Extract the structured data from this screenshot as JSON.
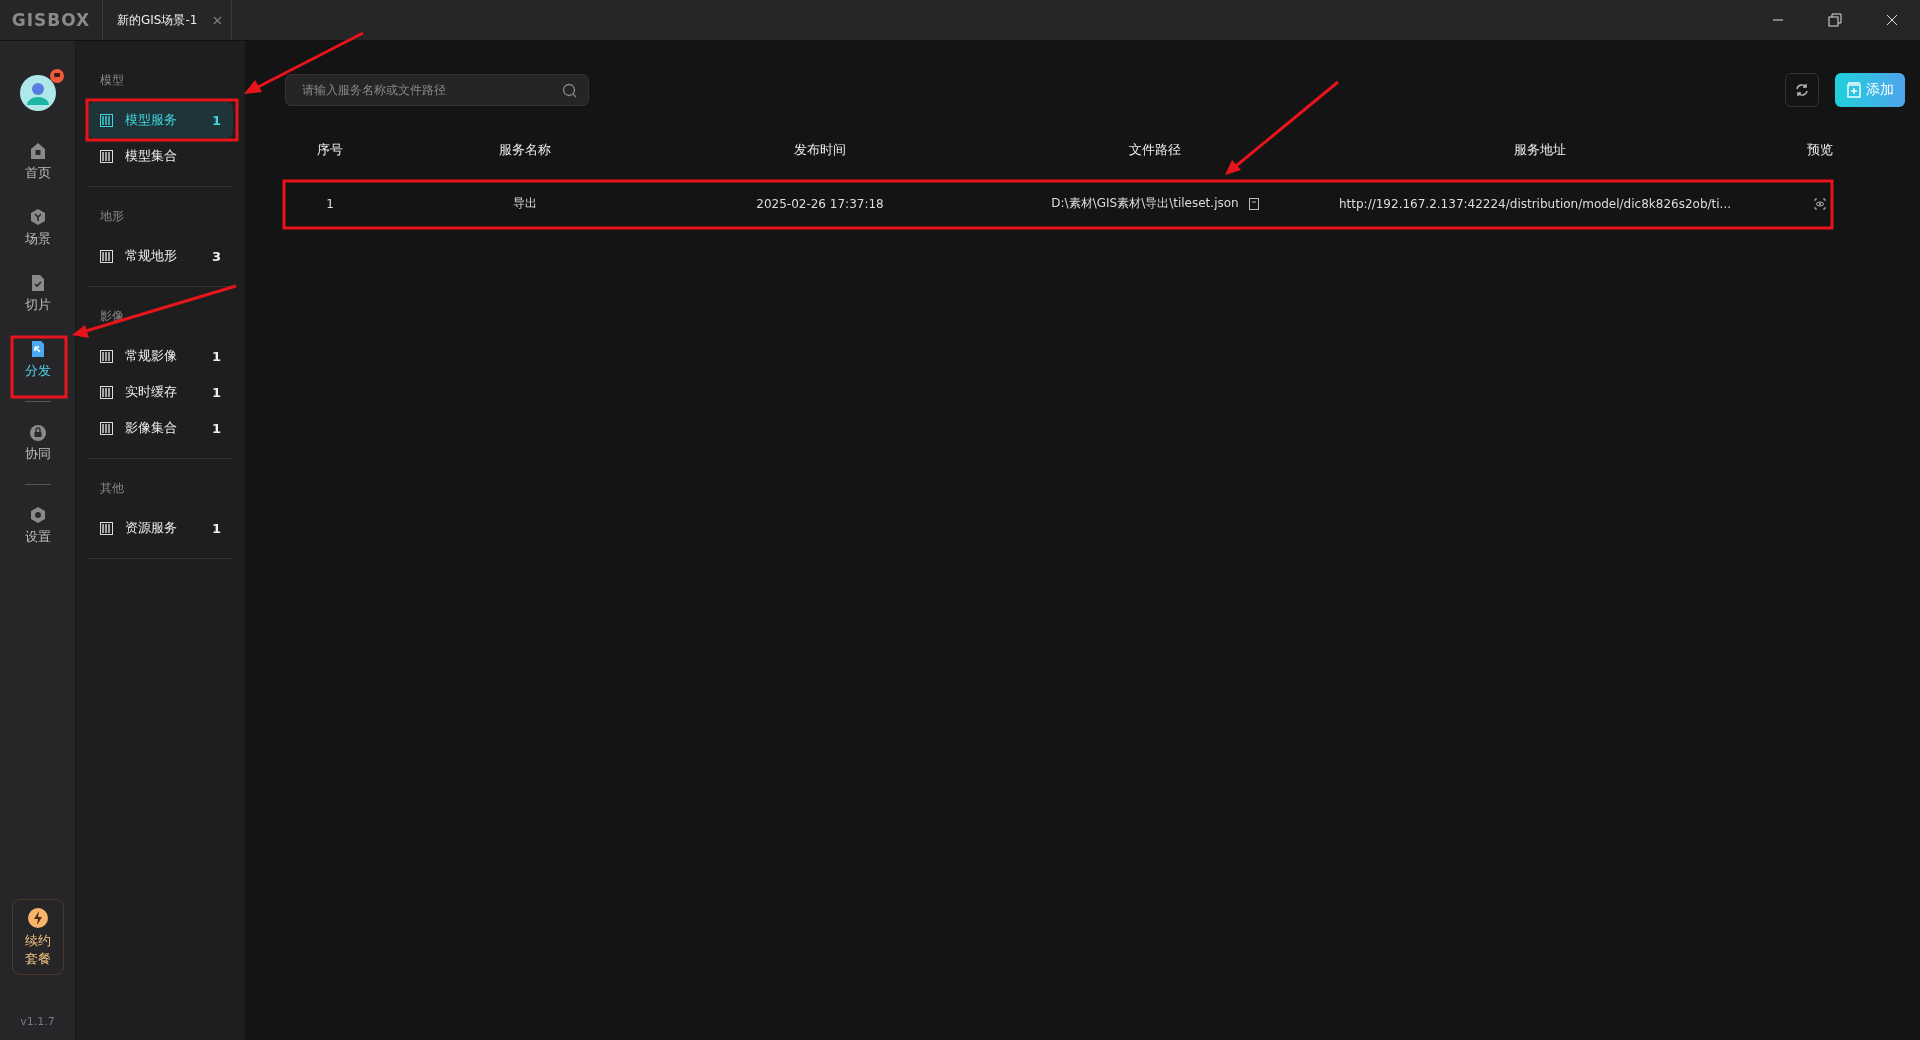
{
  "app": {
    "logo": "GISBOX"
  },
  "tabs": [
    {
      "label": "新的GIS场景-1",
      "close": "×",
      "selected": true
    }
  ],
  "rail": {
    "items": [
      {
        "label": "首页",
        "selected": false
      },
      {
        "label": "场景",
        "selected": false
      },
      {
        "label": "切片",
        "selected": false
      },
      {
        "label": "分发",
        "selected": true
      },
      {
        "label": "协同",
        "selected": false
      },
      {
        "label": "设置",
        "selected": false
      }
    ],
    "renew": [
      "续约",
      "套餐"
    ],
    "version": "v1.1.7"
  },
  "sidebar": {
    "sections": [
      {
        "title": "模型",
        "items": [
          {
            "label": "模型服务",
            "count": "1",
            "selected": true
          },
          {
            "label": "模型集合",
            "selected": false
          }
        ]
      },
      {
        "title": "地形",
        "items": [
          {
            "label": "常规地形",
            "count": "3",
            "selected": false
          }
        ]
      },
      {
        "title": "影像",
        "items": [
          {
            "label": "常规影像",
            "count": "1",
            "selected": false
          },
          {
            "label": "实时缓存",
            "count": "1",
            "selected": false
          },
          {
            "label": "影像集合",
            "count": "1",
            "selected": false
          }
        ]
      },
      {
        "title": "其他",
        "items": [
          {
            "label": "资源服务",
            "count": "1",
            "selected": false
          }
        ]
      }
    ]
  },
  "search": {
    "placeholder": "请输入服务名称或文件路径"
  },
  "add_button": "添加",
  "table": {
    "columns": [
      "序号",
      "服务名称",
      "发布时间",
      "文件路径",
      "服务地址",
      "预览"
    ],
    "rows": [
      {
        "index": "1",
        "name": "导出",
        "time": "2025-02-26 17:37:18",
        "path": "D:\\素材\\GIS素材\\导出\\tileset.json",
        "url": "http://192.167.2.137:42224/distribution/model/dic8k826s2ob/ti..."
      }
    ]
  }
}
